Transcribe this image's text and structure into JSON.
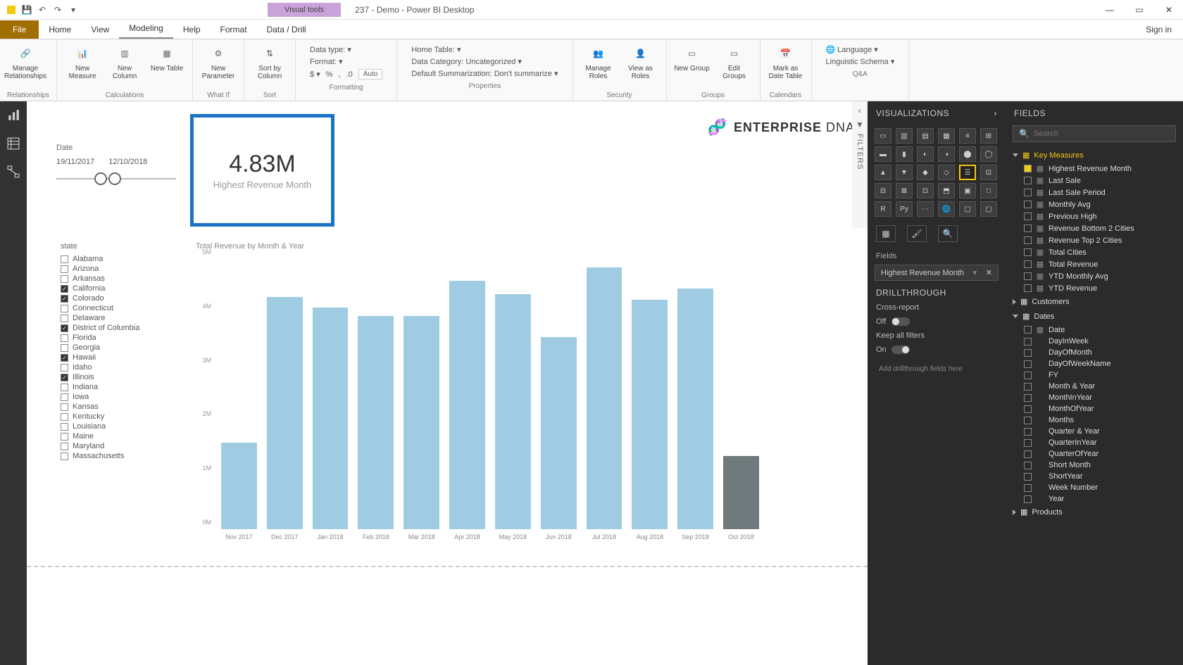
{
  "titlebar": {
    "visual_tools": "Visual tools",
    "doc_title": "237 - Demo - Power BI Desktop"
  },
  "menutabs": {
    "file": "File",
    "tabs": [
      "Home",
      "View",
      "Modeling",
      "Help",
      "Format",
      "Data / Drill"
    ],
    "active": "Modeling",
    "signin": "Sign in"
  },
  "ribbon": {
    "relationships": {
      "btn": "Manage\nRelationships",
      "label": "Relationships"
    },
    "calculations": {
      "b1": "New\nMeasure",
      "b2": "New\nColumn",
      "b3": "New\nTable",
      "label": "Calculations"
    },
    "whatif": {
      "btn": "New\nParameter",
      "label": "What If"
    },
    "sort": {
      "btn": "Sort by\nColumn",
      "label": "Sort"
    },
    "formatting": {
      "datatype": "Data type:",
      "format": "Format:",
      "auto": "Auto",
      "label": "Formatting"
    },
    "properties": {
      "hometable": "Home Table:",
      "datacat": "Data Category: Uncategorized",
      "summ": "Default Summarization: Don't summarize",
      "label": "Properties"
    },
    "security": {
      "b1": "Manage\nRoles",
      "b2": "View as\nRoles",
      "label": "Security"
    },
    "groups": {
      "b1": "New\nGroup",
      "b2": "Edit\nGroups",
      "label": "Groups"
    },
    "calendars": {
      "btn": "Mark as\nDate Table",
      "label": "Calendars"
    },
    "qa": {
      "l1": "Language",
      "l2": "Linguistic Schema",
      "label": "Q&A"
    }
  },
  "date_slicer": {
    "title": "Date",
    "start": "19/11/2017",
    "end": "12/10/2018"
  },
  "card": {
    "value": "4.83M",
    "label": "Highest Revenue Month"
  },
  "state_slicer": {
    "title": "state",
    "items": [
      {
        "name": "Alabama",
        "checked": false
      },
      {
        "name": "Arizona",
        "checked": false
      },
      {
        "name": "Arkansas",
        "checked": false
      },
      {
        "name": "California",
        "checked": true
      },
      {
        "name": "Colorado",
        "checked": true
      },
      {
        "name": "Connecticut",
        "checked": false
      },
      {
        "name": "Delaware",
        "checked": false
      },
      {
        "name": "District of Columbia",
        "checked": true
      },
      {
        "name": "Florida",
        "checked": false
      },
      {
        "name": "Georgia",
        "checked": false
      },
      {
        "name": "Hawaii",
        "checked": true
      },
      {
        "name": "Idaho",
        "checked": false
      },
      {
        "name": "Illinois",
        "checked": true
      },
      {
        "name": "Indiana",
        "checked": false
      },
      {
        "name": "Iowa",
        "checked": false
      },
      {
        "name": "Kansas",
        "checked": false
      },
      {
        "name": "Kentucky",
        "checked": false
      },
      {
        "name": "Louisiana",
        "checked": false
      },
      {
        "name": "Maine",
        "checked": false
      },
      {
        "name": "Maryland",
        "checked": false
      },
      {
        "name": "Massachusetts",
        "checked": false
      }
    ]
  },
  "logo": {
    "brand": "ENTERPRISE",
    "suffix": " DNA"
  },
  "filters_label": "FILTERS",
  "viz_panel": {
    "header": "VISUALIZATIONS",
    "fields_label": "Fields",
    "well_text": "Highest Revenue Month",
    "drill_header": "DRILLTHROUGH",
    "cross": "Cross-report",
    "off": "Off",
    "keep": "Keep all filters",
    "on": "On",
    "drop": "Add drillthrough fields here"
  },
  "fields_panel": {
    "header": "FIELDS",
    "search_placeholder": "Search",
    "tables": [
      {
        "name": "Key Measures",
        "expanded": true,
        "highlighted": true,
        "fields": [
          {
            "name": "Highest Revenue Month",
            "checked": true,
            "icon": "▦"
          },
          {
            "name": "Last Sale",
            "checked": false,
            "icon": "▦"
          },
          {
            "name": "Last Sale Period",
            "checked": false,
            "icon": "▦"
          },
          {
            "name": "Monthly Avg",
            "checked": false,
            "icon": "▦"
          },
          {
            "name": "Previous High",
            "checked": false,
            "icon": "▦"
          },
          {
            "name": "Revenue Bottom 2 Cities",
            "checked": false,
            "icon": "▦"
          },
          {
            "name": "Revenue Top 2 Cities",
            "checked": false,
            "icon": "▦"
          },
          {
            "name": "Total Cities",
            "checked": false,
            "icon": "▦"
          },
          {
            "name": "Total Revenue",
            "checked": false,
            "icon": "▦"
          },
          {
            "name": "YTD Monthly Avg",
            "checked": false,
            "icon": "▦"
          },
          {
            "name": "YTD Revenue",
            "checked": false,
            "icon": "▦"
          }
        ]
      },
      {
        "name": "Customers",
        "expanded": false,
        "highlighted": false
      },
      {
        "name": "Dates",
        "expanded": true,
        "highlighted": false,
        "fields": [
          {
            "name": "Date",
            "checked": false,
            "icon": "▦"
          },
          {
            "name": "DayInWeek",
            "checked": false,
            "icon": ""
          },
          {
            "name": "DayOfMonth",
            "checked": false,
            "icon": ""
          },
          {
            "name": "DayOfWeekName",
            "checked": false,
            "icon": ""
          },
          {
            "name": "FY",
            "checked": false,
            "icon": ""
          },
          {
            "name": "Month & Year",
            "checked": false,
            "icon": ""
          },
          {
            "name": "MonthInYear",
            "checked": false,
            "icon": ""
          },
          {
            "name": "MonthOfYear",
            "checked": false,
            "icon": ""
          },
          {
            "name": "Months",
            "checked": false,
            "icon": ""
          },
          {
            "name": "Quarter & Year",
            "checked": false,
            "icon": ""
          },
          {
            "name": "QuarterInYear",
            "checked": false,
            "icon": ""
          },
          {
            "name": "QuarterOfYear",
            "checked": false,
            "icon": ""
          },
          {
            "name": "Short Month",
            "checked": false,
            "icon": ""
          },
          {
            "name": "ShortYear",
            "checked": false,
            "icon": ""
          },
          {
            "name": "Week Number",
            "checked": false,
            "icon": ""
          },
          {
            "name": "Year",
            "checked": false,
            "icon": ""
          }
        ]
      },
      {
        "name": "Products",
        "expanded": false,
        "highlighted": false
      }
    ]
  },
  "chart_data": {
    "type": "bar",
    "title": "Total Revenue by Month & Year",
    "xlabel": "",
    "ylabel": "",
    "ylim": [
      0,
      5
    ],
    "yticks": [
      "0M",
      "1M",
      "2M",
      "3M",
      "4M",
      "5M"
    ],
    "categories": [
      "Nov 2017",
      "Dec 2017",
      "Jan 2018",
      "Feb 2018",
      "Mar 2018",
      "Apr 2018",
      "May 2018",
      "Jun 2018",
      "Jul 2018",
      "Aug 2018",
      "Sep 2018",
      "Oct 2018"
    ],
    "values": [
      1.6,
      4.3,
      4.1,
      3.95,
      3.95,
      4.6,
      4.35,
      3.55,
      4.85,
      4.25,
      4.45,
      1.35
    ],
    "highlight_last": true
  }
}
